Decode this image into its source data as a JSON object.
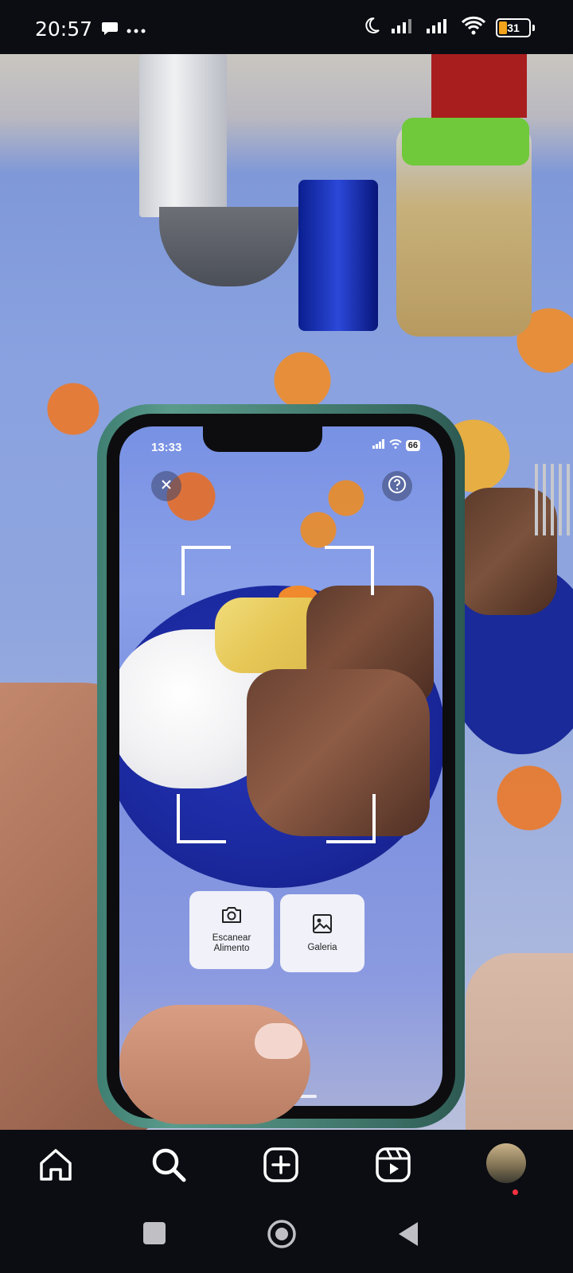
{
  "status_bar": {
    "time": "20:57",
    "notification_icon": "chat-bubble-icon",
    "more_icon": "more-dots-icon",
    "signal_icons": [
      "moon-icon",
      "signal-icon",
      "signal-icon",
      "wifi-icon"
    ],
    "battery_level": "31",
    "battery_color": "#f2a31b"
  },
  "video": {
    "inner_phone": {
      "status_time": "13:33",
      "battery": "66",
      "close_icon": "close-icon",
      "help_icon": "help-icon",
      "buttons": {
        "scan_label_line1": "Escanear",
        "scan_label_line2": "Alimento",
        "gallery_label": "Galeria"
      }
    }
  },
  "bottom_nav": {
    "items": [
      {
        "name": "home-icon",
        "active": true
      },
      {
        "name": "search-icon"
      },
      {
        "name": "create-icon"
      },
      {
        "name": "reels-icon"
      },
      {
        "name": "profile-avatar",
        "has_notification": true
      }
    ]
  },
  "system_nav": [
    "recents-button",
    "home-button",
    "back-button"
  ],
  "colors": {
    "background": "#0b0d12",
    "notification_dot": "#ff3040",
    "phone_case": "#4f8b7c"
  }
}
